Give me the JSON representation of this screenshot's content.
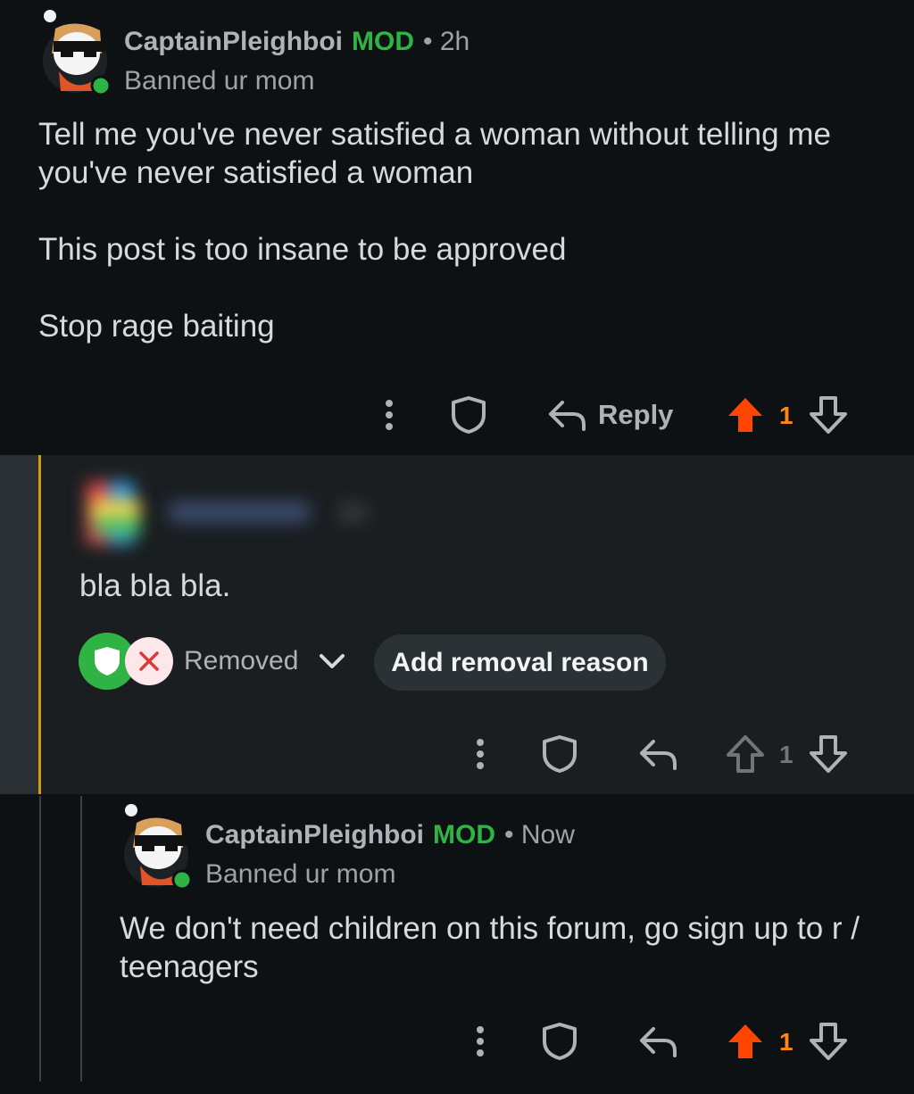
{
  "colors": {
    "background": "#0e1113",
    "highlight_background": "#1a1e21",
    "mod_green": "#2fb344",
    "upvote_red": "#ff4500",
    "count_orange": "#ff8717",
    "thread_line_yellow": "#d49a1a",
    "removal_chip": "#2a3236"
  },
  "comments": [
    {
      "username": "CaptainPleighboi",
      "mod_badge": "MOD",
      "time": "• 2h",
      "flair": "Banned ur mom",
      "text": "Tell me you've never satisfied a woman without telling me you've never satisfied a woman\n\nThis post is too insane to be approved\n\nStop rage baiting",
      "reply_label": "Reply",
      "vote_count": "1",
      "upvoted": true
    },
    {
      "username_hidden": true,
      "time": "1h",
      "text": "bla bla bla.",
      "status": "Removed",
      "removal_button": "Add removal reason",
      "vote_count": "1",
      "upvoted": false
    },
    {
      "username": "CaptainPleighboi",
      "mod_badge": "MOD",
      "time": "• Now",
      "flair": "Banned ur mom",
      "text": "We don't need children on this forum, go sign up to r / teenagers",
      "vote_count": "1",
      "upvoted": true
    }
  ],
  "icons": [
    "more-vertical-icon",
    "shield-icon",
    "reply-arrow-icon",
    "upvote-icon",
    "downvote-icon",
    "chevron-down-icon",
    "close-icon",
    "mod-shield-icon"
  ]
}
